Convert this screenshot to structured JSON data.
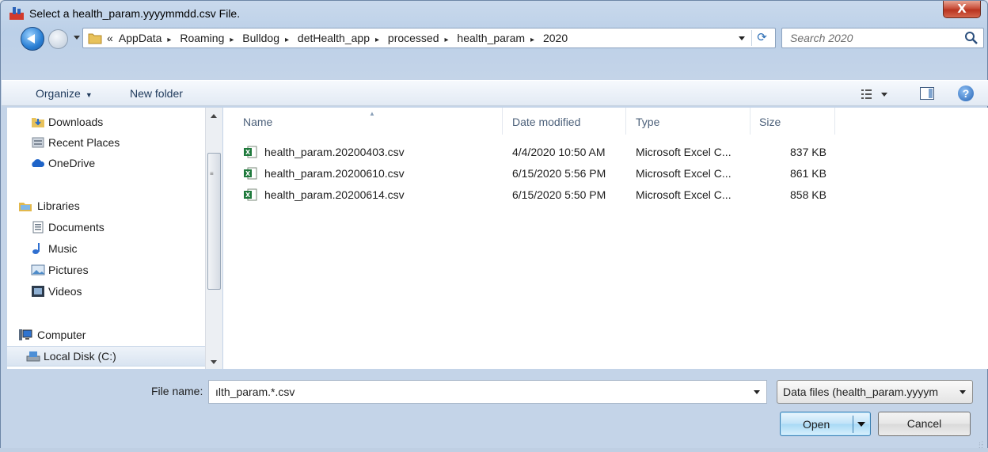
{
  "window": {
    "title": "Select a health_param.yyyymmdd.csv File.",
    "close_label": "X"
  },
  "address": {
    "overflow": "«",
    "crumbs": [
      "AppData",
      "Roaming",
      "Bulldog",
      "detHealth_app",
      "processed",
      "health_param",
      "2020"
    ],
    "separator": "▸"
  },
  "search": {
    "placeholder": "Search 2020"
  },
  "toolbar": {
    "organize_label": "Organize",
    "organize_caret": "▼",
    "new_folder_label": "New folder",
    "help_label": "?"
  },
  "nav": {
    "items": [
      {
        "label": "Downloads",
        "icon": "downloads-folder-icon"
      },
      {
        "label": "Recent Places",
        "icon": "recent-places-icon"
      },
      {
        "label": "OneDrive",
        "icon": "onedrive-cloud-icon"
      },
      {
        "label": "Libraries",
        "icon": "libraries-icon"
      },
      {
        "label": "Documents",
        "icon": "documents-icon"
      },
      {
        "label": "Music",
        "icon": "music-icon"
      },
      {
        "label": "Pictures",
        "icon": "pictures-icon"
      },
      {
        "label": "Videos",
        "icon": "videos-icon"
      },
      {
        "label": "Computer",
        "icon": "computer-icon"
      },
      {
        "label": "Local Disk (C:)",
        "icon": "local-disk-icon"
      }
    ]
  },
  "files": {
    "columns": [
      "Name",
      "Date modified",
      "Type",
      "Size"
    ],
    "sort_indicator": "▲",
    "rows": [
      {
        "name": "health_param.20200403.csv",
        "date": "4/4/2020 10:50 AM",
        "type": "Microsoft Excel C...",
        "size": "837 KB"
      },
      {
        "name": "health_param.20200610.csv",
        "date": "6/15/2020 5:56 PM",
        "type": "Microsoft Excel C...",
        "size": "861 KB"
      },
      {
        "name": "health_param.20200614.csv",
        "date": "6/15/2020 5:50 PM",
        "type": "Microsoft Excel C...",
        "size": "858 KB"
      }
    ]
  },
  "bottom": {
    "file_name_label": "File name:",
    "file_name_value": "ılth_param.*.csv",
    "file_type_value": "Data files (health_param.yyyym",
    "open_label": "Open",
    "cancel_label": "Cancel"
  },
  "colors": {
    "accent": "#2a7fd4",
    "close_red": "#c9503b",
    "excel_green": "#1f7a3c"
  }
}
